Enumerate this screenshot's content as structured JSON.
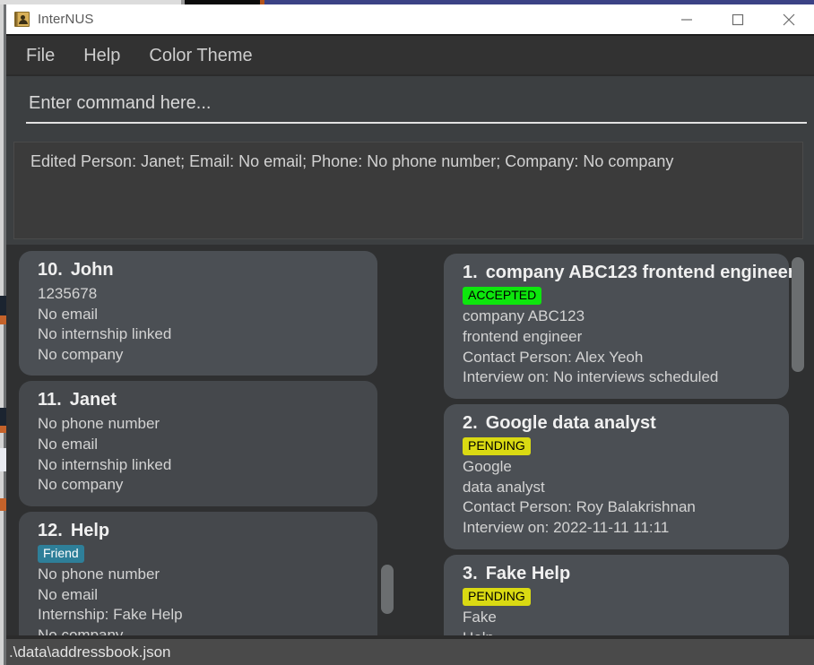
{
  "window": {
    "title": "InterNUS",
    "icon": "address-book-icon",
    "controls": {
      "minimize": "minimize-icon",
      "maximize": "maximize-icon",
      "close": "close-icon"
    }
  },
  "menubar": {
    "items": [
      {
        "label": "File"
      },
      {
        "label": "Help"
      },
      {
        "label": "Color Theme"
      }
    ]
  },
  "command": {
    "placeholder": "Enter command here...",
    "value": ""
  },
  "result": {
    "text": "Edited Person: Janet; Email: No email; Phone: No phone number; Company: No company"
  },
  "person_list": {
    "cards": [
      {
        "index": "10.",
        "name": "John",
        "tags": [],
        "lines": [
          "1235678",
          "No email",
          "No internship linked",
          "No company"
        ]
      },
      {
        "index": "11.",
        "name": "Janet",
        "tags": [],
        "lines": [
          "No phone number",
          "No email",
          "No internship linked",
          "No company"
        ]
      },
      {
        "index": "12.",
        "name": "Help",
        "tags": [
          {
            "label": "Friend",
            "style": "friend"
          }
        ],
        "lines": [
          "No phone number",
          "No email",
          "Internship: Fake Help",
          "No company"
        ]
      }
    ]
  },
  "internship_list": {
    "cards": [
      {
        "index": "1.",
        "name": "company ABC123 frontend engineer",
        "tags": [
          {
            "label": "ACCEPTED",
            "style": "accepted"
          }
        ],
        "lines": [
          "company ABC123",
          "frontend engineer",
          "Contact Person: Alex Yeoh",
          "Interview on: No interviews scheduled"
        ]
      },
      {
        "index": "2.",
        "name": "Google data analyst",
        "tags": [
          {
            "label": "PENDING",
            "style": "pending"
          }
        ],
        "lines": [
          "Google",
          "data analyst",
          "Contact Person: Roy Balakrishnan",
          "Interview on: 2022-11-11 11:11"
        ]
      },
      {
        "index": "3.",
        "name": "Fake Help",
        "tags": [
          {
            "label": "PENDING",
            "style": "pending"
          }
        ],
        "lines": [
          "Fake",
          "Help"
        ]
      }
    ]
  },
  "statusbar": {
    "path": ".\\data\\addressbook.json"
  },
  "colors": {
    "window_bg": "#3c3f41",
    "panel_bg": "#2f3031",
    "card_bg": "#4b4f54",
    "card_bg_alt": "#45484c",
    "titlebar_bg": "#ffffff",
    "menubar_bg": "#323232",
    "statusbar_bg": "#4a4a4a",
    "tag_friend": "#2e7f99",
    "tag_accepted": "#0de60d",
    "tag_pending": "#dada12",
    "text_primary": "#f0f0f0",
    "text_secondary": "#d3d3d3"
  }
}
